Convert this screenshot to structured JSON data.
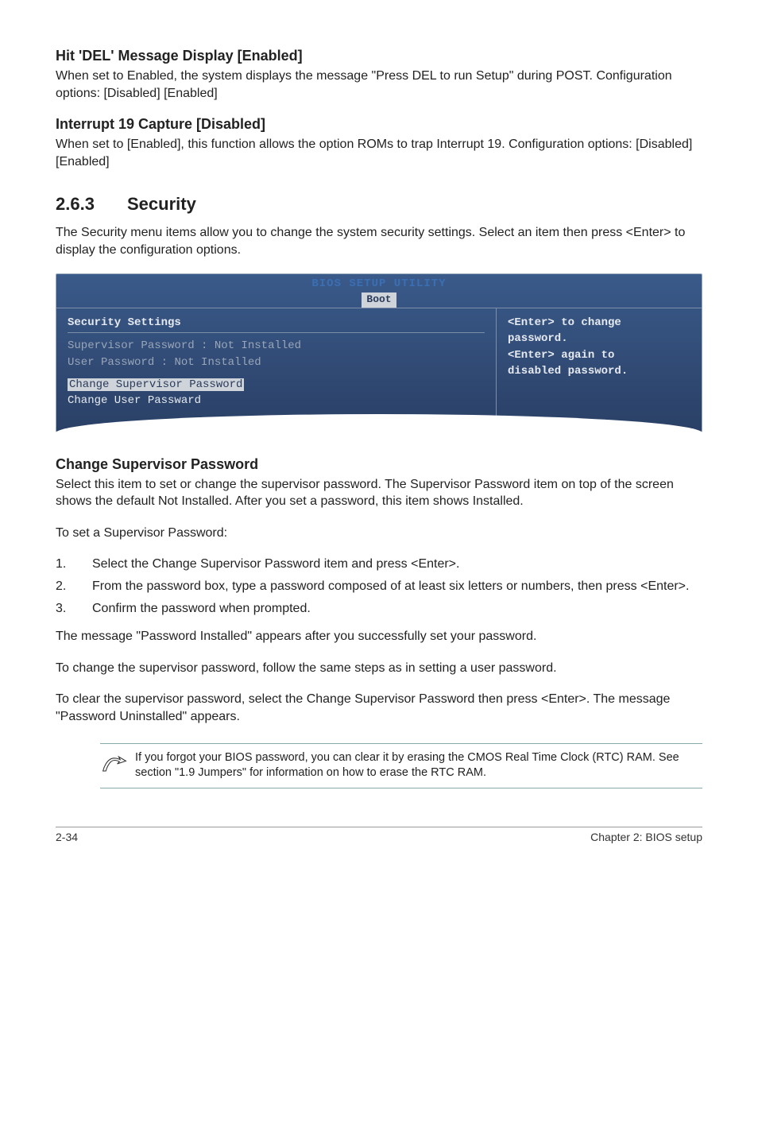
{
  "sec1": {
    "title": "Hit 'DEL' Message Display [Enabled]",
    "body": "When set to Enabled, the system displays the message \"Press DEL to run Setup\" during POST. Configuration options: [Disabled] [Enabled]"
  },
  "sec2": {
    "title": "Interrupt 19 Capture [Disabled]",
    "body": "When set to [Enabled], this function allows the option ROMs to trap Interrupt 19. Configuration options: [Disabled] [Enabled]"
  },
  "section": {
    "num": "2.6.3",
    "title": "Security",
    "intro": "The Security menu items allow you to change the system security settings. Select an item then press <Enter> to display the configuration options."
  },
  "bios": {
    "headerTop": "BIOS SETUP UTILITY",
    "headerTab": "Boot",
    "left": {
      "title": "Security Settings",
      "r1_label": "Supervisor Password",
      "r1_sep": "  : ",
      "r1_val": "Not Installed",
      "r2_label": "User Password",
      "r2_sep": "        : ",
      "r2_val": "Not Installed",
      "sel": "Change Supervisor Password",
      "r4": "Change User Passward"
    },
    "right": {
      "l1": "<Enter> to change",
      "l2": "password.",
      "l3": "<Enter> again to",
      "l4": "disabled password."
    }
  },
  "csp": {
    "title": "Change Supervisor Password",
    "p1": "Select this item to set or change the supervisor password. The Supervisor Password item on top of the screen shows the default Not Installed. After you set a password, this item shows Installed.",
    "p2": "To set a Supervisor Password:",
    "li1": "Select the Change Supervisor Password item and press <Enter>.",
    "li2": "From the password box, type a password composed of at least six letters or numbers, then press <Enter>.",
    "li3": "Confirm the password when prompted.",
    "p3": "The message \"Password Installed\" appears after you successfully set your password.",
    "p4": "To change the supervisor password, follow the same steps as in setting a user password.",
    "p5": "To clear the supervisor password, select the Change Supervisor Password then press <Enter>. The message \"Password Uninstalled\" appears."
  },
  "note": "If you forgot your BIOS password, you can clear it by erasing the CMOS Real Time Clock (RTC) RAM. See section \"1.9  Jumpers\" for information on how to erase the RTC RAM.",
  "footer": {
    "left": "2-34",
    "right": "Chapter 2: BIOS setup"
  }
}
